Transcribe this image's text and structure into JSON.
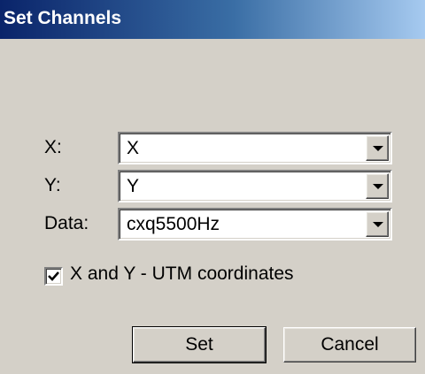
{
  "window": {
    "title": "Set Channels"
  },
  "fields": {
    "x": {
      "label": "X:",
      "value": "X"
    },
    "y": {
      "label": "Y:",
      "value": "Y"
    },
    "data": {
      "label": "Data:",
      "value": "cxq5500Hz"
    }
  },
  "utm_checkbox": {
    "label": "X and Y - UTM coordinates",
    "checked": true
  },
  "buttons": {
    "set": "Set",
    "cancel": "Cancel"
  },
  "colors": {
    "title_gradient_start": "#0a246a",
    "title_gradient_end": "#a6caf0",
    "dialog_face": "#d4d0c8"
  },
  "icons": {
    "dropdown": "chevron-down-icon",
    "check": "checkmark-icon"
  }
}
